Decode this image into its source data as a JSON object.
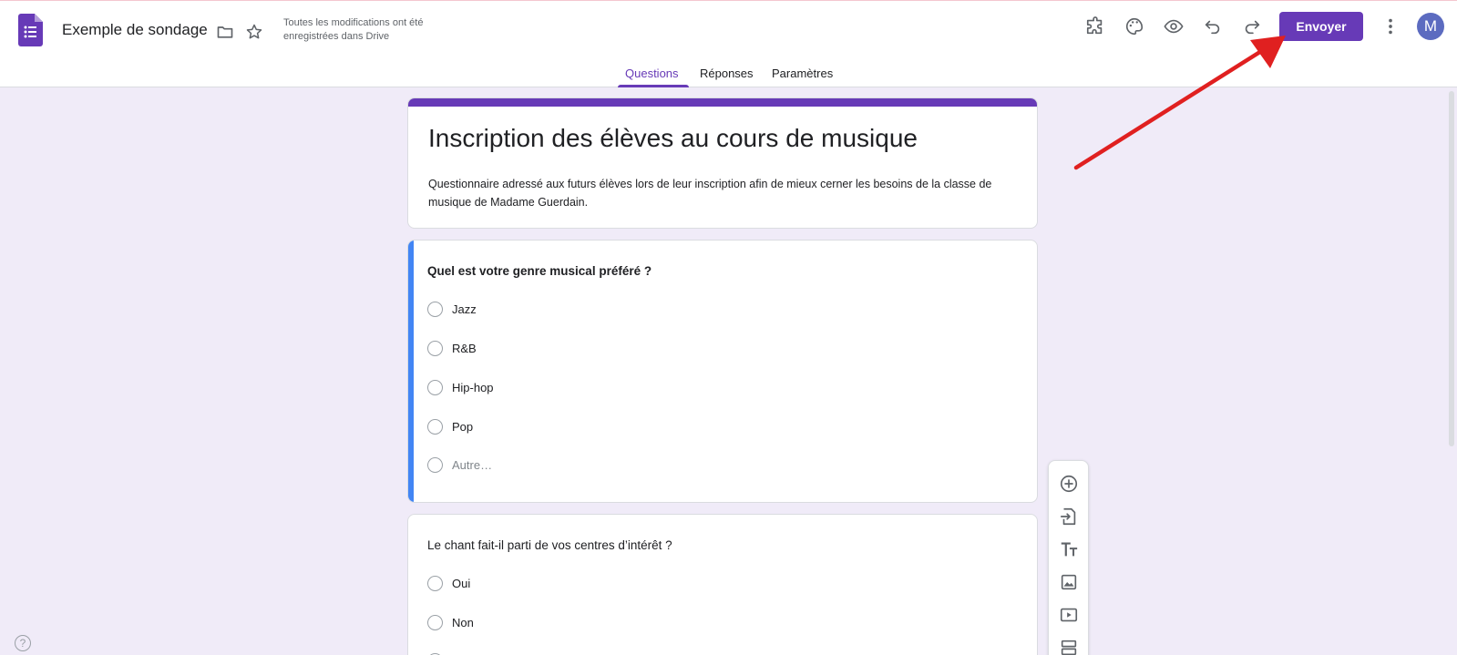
{
  "header": {
    "doc_title": "Exemple de sondage",
    "save_status": "Toutes les modifications ont été enregistrées dans Drive",
    "send_label": "Envoyer",
    "avatar_initial": "M"
  },
  "tabs": [
    {
      "label": "Questions",
      "active": true
    },
    {
      "label": "Réponses",
      "active": false
    },
    {
      "label": "Paramètres",
      "active": false
    }
  ],
  "form": {
    "title": "Inscription des élèves au cours de musique",
    "description": "Questionnaire adressé aux futurs élèves lors de leur inscription afin de mieux cerner les besoins de la classe de musique de Madame Guerdain."
  },
  "questions": [
    {
      "text": "Quel est votre genre musical préféré ?",
      "options": [
        "Jazz",
        "R&B",
        "Hip-hop",
        "Pop",
        "Autre…"
      ]
    },
    {
      "text": "Le chant fait-il parti de vos centres d’intérêt ?",
      "options": [
        "Oui",
        "Non"
      ]
    }
  ],
  "help_symbol": "?",
  "colors": {
    "accent": "#673ab7",
    "active_question": "#4285f4",
    "background": "#f0ebf8",
    "annotation_arrow": "#e02020"
  }
}
